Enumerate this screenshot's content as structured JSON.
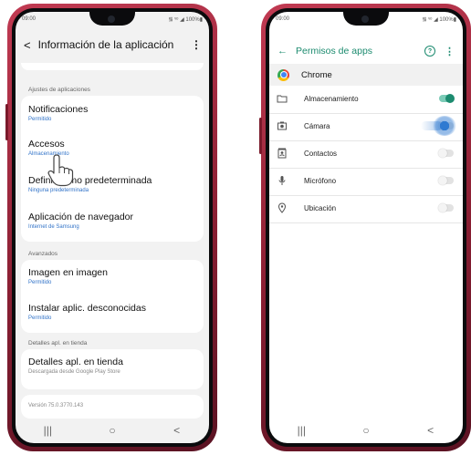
{
  "left_phone": {
    "status_time": "09:00",
    "status_right": "᯾ ᵛᵒ ◢ 100%▮",
    "header": {
      "title": "Información de la aplicación"
    },
    "section_app_settings": "Ajustes de aplicaciones",
    "items": [
      {
        "title": "Notificaciones",
        "subtitle": "Permitido"
      },
      {
        "title": "Accesos",
        "subtitle": "Almacenamiento"
      },
      {
        "title": "Definir como predeterminada",
        "subtitle": "Ninguna predeterminada"
      },
      {
        "title": "Aplicación de navegador",
        "subtitle": "Internet de Samsung"
      }
    ],
    "section_advanced": "Avanzados",
    "advanced_items": [
      {
        "title": "Imagen en imagen",
        "subtitle": "Permitido"
      },
      {
        "title": "Instalar aplic. desconocidas",
        "subtitle": "Permitido"
      }
    ],
    "section_store": "Detalles apl. en tienda",
    "store_item": {
      "title": "Detalles apl. en tienda",
      "subtitle": "Descargada desde Google Play Store"
    },
    "version": "Versión 75.0.3770.143",
    "nav": {
      "recent": "|||",
      "home": "○",
      "back": "<"
    }
  },
  "right_phone": {
    "status_time": "09:00",
    "status_right": "᯾ ᵛᵒ ◢ 100%▮",
    "header": {
      "back": "←",
      "title": "Permisos de apps",
      "help": "?"
    },
    "app_name": "Chrome",
    "permissions": [
      {
        "label": "Almacenamiento",
        "icon": "folder-icon",
        "enabled": true
      },
      {
        "label": "Cámara",
        "icon": "camera-icon",
        "enabled": false
      },
      {
        "label": "Contactos",
        "icon": "contacts-icon",
        "enabled": false
      },
      {
        "label": "Micrófono",
        "icon": "microphone-icon",
        "enabled": false
      },
      {
        "label": "Ubicación",
        "icon": "location-icon",
        "enabled": false
      }
    ],
    "nav": {
      "recent": "|||",
      "home": "○",
      "back": "<"
    }
  },
  "colors": {
    "accent_green": "#1c8b6f",
    "link_blue": "#3173c8",
    "phone_body": "#a62a42"
  }
}
